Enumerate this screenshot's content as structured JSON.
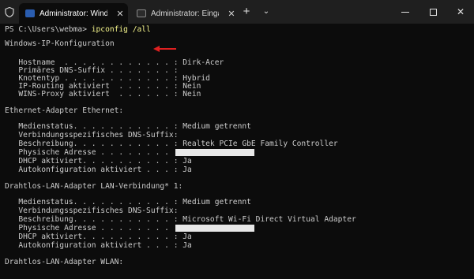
{
  "tabs": [
    {
      "label": "Administrator: Windows PowerShell",
      "active": true,
      "icon": "powershell-icon"
    },
    {
      "label": "Administrator: Eingabeaufforderung",
      "active": false,
      "icon": "cmd-icon"
    }
  ],
  "window": {
    "new_tab": "+",
    "dropdown": "⌄",
    "close": "✕"
  },
  "prompt": {
    "path": "PS C:\\Users\\webma>",
    "command": "ipconfig /all"
  },
  "sections": {
    "windows_ip": {
      "header": "Windows-IP-Konfiguration",
      "rows": [
        "   Hostname  . . . . . . . . . . . . : Dirk-Acer",
        "   Primäres DNS-Suffix . . . . . . . :",
        "   Knotentyp . . . . . . . . . . . . : Hybrid",
        "   IP-Routing aktiviert  . . . . . . : Nein",
        "   WINS-Proxy aktiviert  . . . . . . : Nein"
      ]
    },
    "ethernet": {
      "header": "Ethernet-Adapter Ethernet:",
      "rows": [
        "   Medienstatus. . . . . . . . . . . : Medium getrennt",
        "   Verbindungsspezifisches DNS-Suffix:",
        "   Beschreibung. . . . . . . . . . . : Realtek PCIe GbE Family Controller",
        "   Physische Adresse . . . . . . . . :",
        "   DHCP aktiviert. . . . . . . . . . : Ja",
        "   Autokonfiguration aktiviert . . . : Ja"
      ]
    },
    "lan_connection": {
      "header": "Drahtlos-LAN-Adapter LAN-Verbindung* 1:",
      "rows": [
        "   Medienstatus. . . . . . . . . . . : Medium getrennt",
        "   Verbindungsspezifisches DNS-Suffix:",
        "   Beschreibung. . . . . . . . . . . : Microsoft Wi-Fi Direct Virtual Adapter",
        "   Physische Adresse . . . . . . . . :",
        "   DHCP aktiviert. . . . . . . . . . : Ja",
        "   Autokonfiguration aktiviert . . . : Ja"
      ]
    },
    "wlan": {
      "header": "Drahtlos-LAN-Adapter WLAN:"
    }
  },
  "colors": {
    "background": "#0c0c0c",
    "text": "#cccccc",
    "command": "#f2f28a",
    "arrow": "#e02020"
  }
}
